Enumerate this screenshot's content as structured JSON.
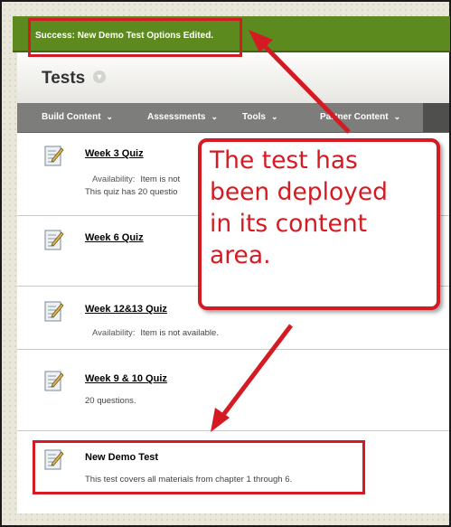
{
  "notification": {
    "text": "Success: New Demo Test Options Edited."
  },
  "page": {
    "title": "Tests"
  },
  "toolbar": {
    "items": [
      {
        "label": "Build Content"
      },
      {
        "label": "Assessments"
      },
      {
        "label": "Tools"
      },
      {
        "label": "Partner Content"
      }
    ]
  },
  "items": [
    {
      "title": "Week 3 Quiz",
      "availability_label": "Availability:",
      "availability_value": "Item is not",
      "description": "This quiz has 20 questio"
    },
    {
      "title": "Week 6 Quiz"
    },
    {
      "title": "Week 12&13 Quiz",
      "availability_label": "Availability:",
      "availability_value": "Item is not available."
    },
    {
      "title": "Week 9 & 10 Quiz",
      "description": "20 questions."
    },
    {
      "title": "New Demo Test",
      "description": "This test covers all materials from chapter 1 through 6."
    }
  ],
  "callout": {
    "lines": [
      "The test has",
      "been deployed",
      "in its content",
      "area."
    ]
  },
  "colors": {
    "annotation_red": "#d41b23",
    "success_green": "#5c8a1f",
    "toolbar_gray": "#7d7d7b"
  },
  "icons": {
    "item": "test-document-pencil-icon"
  }
}
